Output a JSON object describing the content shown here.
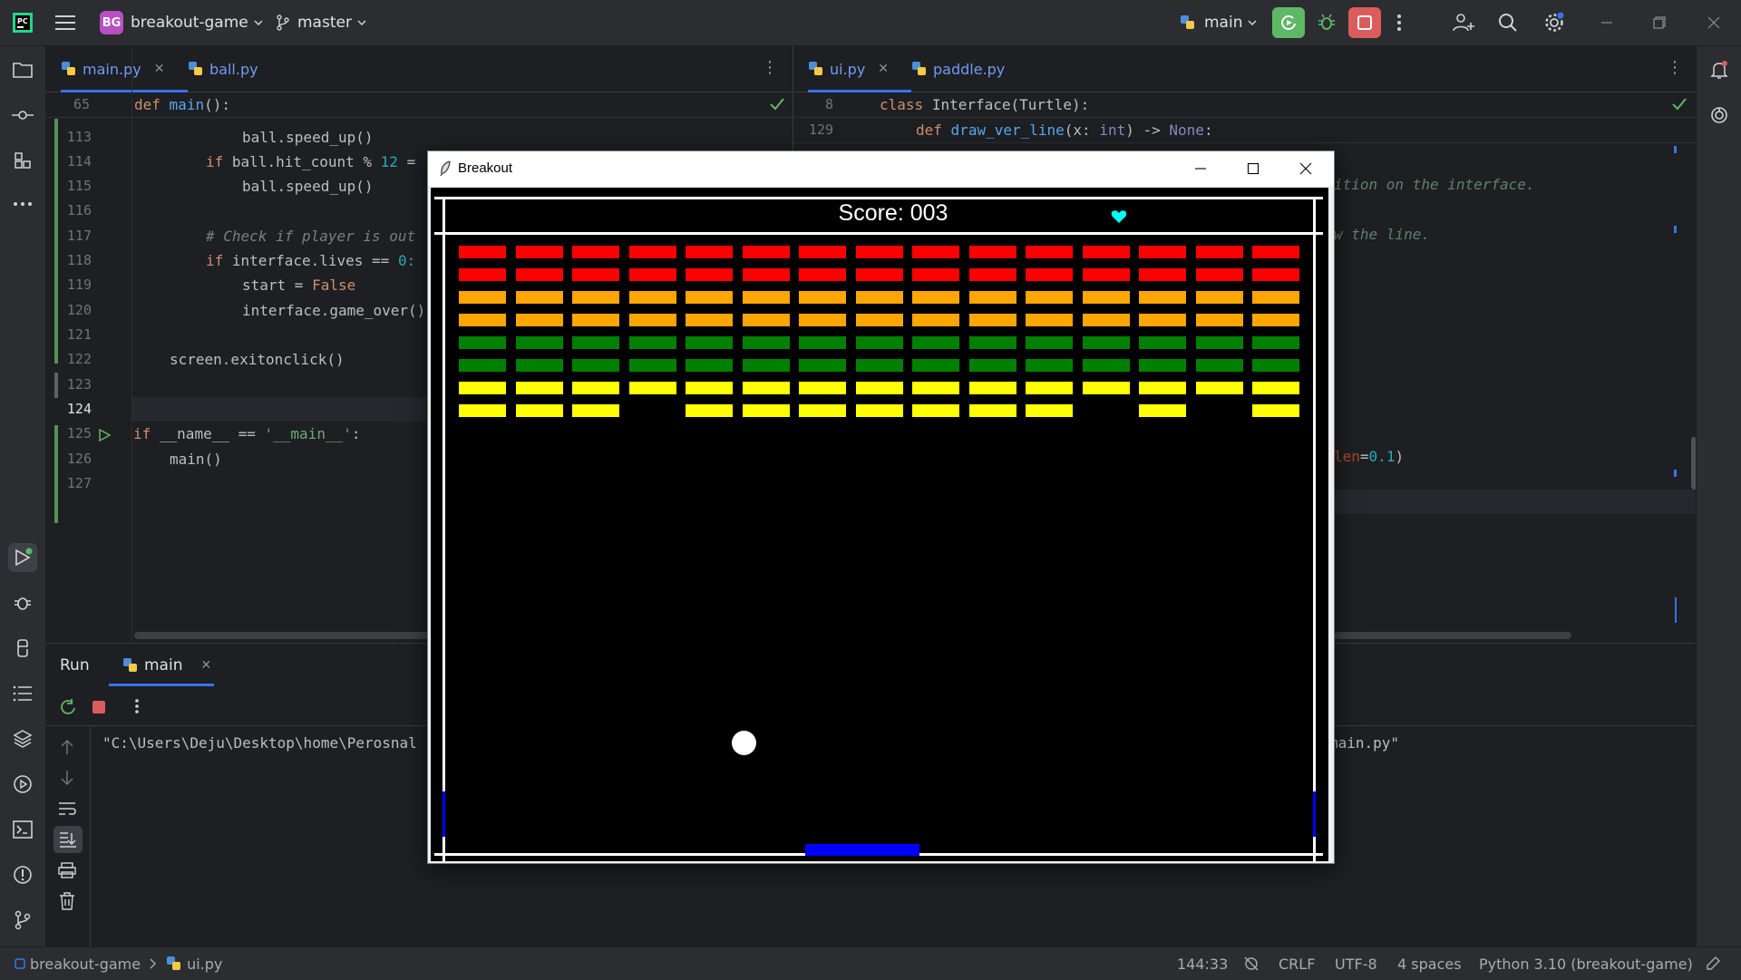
{
  "titlebar": {
    "project_badge": "BG",
    "project_name": "breakout-game",
    "branch": "master",
    "run_config": "main",
    "icons": [
      "pycharm-logo-icon",
      "hamburger-menu-icon",
      "branch-icon",
      "run-icon",
      "debug-icon",
      "stop-icon",
      "more-icon",
      "add-user-icon",
      "search-icon",
      "settings-icon",
      "minimize-icon",
      "restore-icon",
      "close-icon"
    ]
  },
  "left_editor": {
    "tabs": [
      {
        "label": "main.py",
        "active": true,
        "closable": true
      },
      {
        "label": "ball.py",
        "active": false,
        "closable": false
      }
    ],
    "sticky": {
      "num": "65",
      "kw": "def",
      "name": "main",
      "rest": "():"
    },
    "line_numbers": [
      "113",
      "114",
      "115",
      "116",
      "117",
      "118",
      "119",
      "120",
      "121",
      "122",
      "123",
      "124",
      "125",
      "126",
      "127"
    ],
    "code": {
      "l113": "ball.speed_up()",
      "l114_kw": "if",
      "l114_rest": "ball.hit_count %",
      "l114_num": "12",
      "l114_tail": "=",
      "l115": "ball.speed_up()",
      "l117": "# Check if player is out",
      "l118_kw": "if",
      "l118_rest": "interface.lives ==",
      "l118_num": "0:",
      "l119_a": "start =",
      "l119_kw": "False",
      "l120": "interface.game_over()",
      "l122": "screen.exitonclick()",
      "l125_kw": "if",
      "l125_a": "__name__ ==",
      "l125_str": "'__main__'",
      "l125_b": ":",
      "l126": "main()"
    }
  },
  "right_editor": {
    "tabs": [
      {
        "label": "ui.py",
        "active": true,
        "closable": true
      },
      {
        "label": "paddle.py",
        "active": false,
        "closable": false
      }
    ],
    "sticky": {
      "num": "8",
      "kw": "class",
      "name": "Interface",
      "rest": "(Turtle):"
    },
    "line129": {
      "num": "129",
      "kw": "def",
      "fn": "draw_ver_line",
      "a": "(x:",
      "type": "int",
      "b": ") ->",
      "none": "None",
      ":": ":"
    },
    "comment_1": "ition on the interface.",
    "comment_2": "w the line.",
    "fragment_param": "len",
    "fragment_eq": "=",
    "fragment_num": "0.1",
    "fragment_close": ")"
  },
  "run_panel": {
    "title": "Run",
    "tab_label": "main",
    "output_left": "\"C:\\Users\\Deju\\Desktop\\home\\Perosnal",
    "output_right": "main.py\""
  },
  "statusbar": {
    "project": "breakout-game",
    "file": "ui.py",
    "position": "144:33",
    "line_sep": "CRLF",
    "encoding": "UTF-8",
    "indent": "4 spaces",
    "interpreter": "Python 3.10 (breakout-game)"
  },
  "game_window": {
    "title": "Breakout",
    "score_label": "Score: 003",
    "lives": 1,
    "colors": {
      "red": "#ff0000",
      "orange": "#ffa500",
      "green": "#008000",
      "yellow": "#ffff00",
      "paddle": "#0000ff",
      "heart": "#00ffff",
      "ball": "#ffffff"
    },
    "brick_rows": [
      {
        "color": "red",
        "present": [
          1,
          1,
          1,
          1,
          1,
          1,
          1,
          1,
          1,
          1,
          1,
          1,
          1,
          1,
          1
        ]
      },
      {
        "color": "red",
        "present": [
          1,
          1,
          1,
          1,
          1,
          1,
          1,
          1,
          1,
          1,
          1,
          1,
          1,
          1,
          1
        ]
      },
      {
        "color": "orange",
        "present": [
          1,
          1,
          1,
          1,
          1,
          1,
          1,
          1,
          1,
          1,
          1,
          1,
          1,
          1,
          1
        ]
      },
      {
        "color": "orange",
        "present": [
          1,
          1,
          1,
          1,
          1,
          1,
          1,
          1,
          1,
          1,
          1,
          1,
          1,
          1,
          1
        ]
      },
      {
        "color": "green",
        "present": [
          1,
          1,
          1,
          1,
          1,
          1,
          1,
          1,
          1,
          1,
          1,
          1,
          1,
          1,
          1
        ]
      },
      {
        "color": "green",
        "present": [
          1,
          1,
          1,
          1,
          1,
          1,
          1,
          1,
          1,
          1,
          1,
          1,
          1,
          1,
          1
        ]
      },
      {
        "color": "yellow",
        "present": [
          1,
          1,
          1,
          1,
          1,
          1,
          1,
          1,
          1,
          1,
          1,
          1,
          1,
          1,
          1
        ]
      },
      {
        "color": "yellow",
        "present": [
          1,
          1,
          1,
          0,
          1,
          1,
          1,
          1,
          1,
          1,
          1,
          0,
          1,
          0,
          1
        ]
      }
    ]
  }
}
